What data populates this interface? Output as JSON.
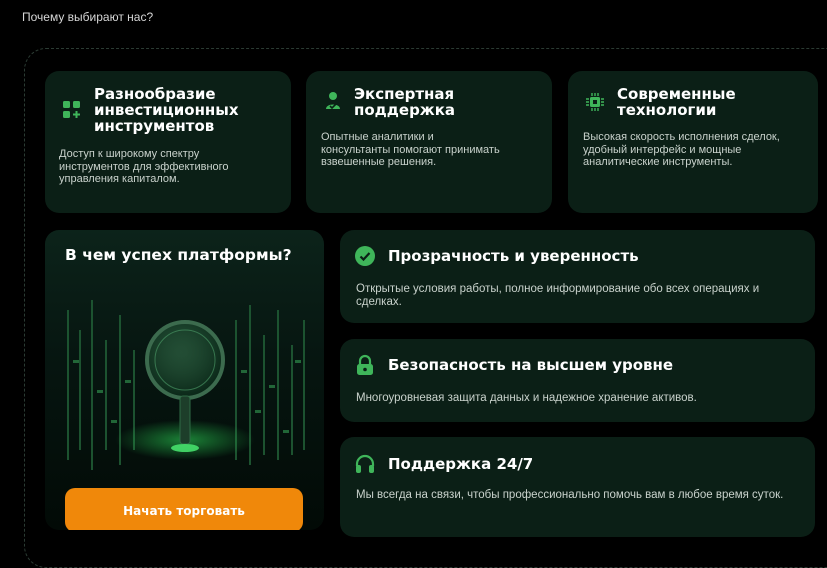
{
  "header": {
    "label": "Почему выбирают нас?"
  },
  "top_cards": [
    {
      "icon": "grid-plus-icon",
      "title": "Разнообразие инвестиционных инструментов",
      "desc": "Доступ к широкому спектру инструментов для эффективного управления капиталом."
    },
    {
      "icon": "person-support-icon",
      "title": "Экспертная поддержка",
      "desc": "Опытные аналитики и консультанты помогают принимать взвешенные решения."
    },
    {
      "icon": "chip-icon",
      "title": "Современные технологии",
      "desc": "Высокая скорость исполнения сделок, удобный интерфейс и мощные аналитические инструменты."
    }
  ],
  "hero": {
    "title": "В чем успех платформы?",
    "cta_label": "Начать торговать"
  },
  "features": [
    {
      "icon": "check-circle-icon",
      "title": "Прозрачность и уверенность",
      "desc": "Открытые условия работы, полное информирование обо всех операциях и сделках."
    },
    {
      "icon": "lock-icon",
      "title": "Безопасность на высшем уровне",
      "desc": "Многоуровневая защита данных и надежное хранение активов."
    },
    {
      "icon": "headphones-icon",
      "title": "Поддержка 24/7",
      "desc": "Мы всегда на связи, чтобы профессионально помочь вам в любое время суток."
    }
  ],
  "colors": {
    "accent": "#3fb55a",
    "cta": "#f0880a",
    "card_bg": "#0b1f16",
    "page_bg": "#000000"
  }
}
